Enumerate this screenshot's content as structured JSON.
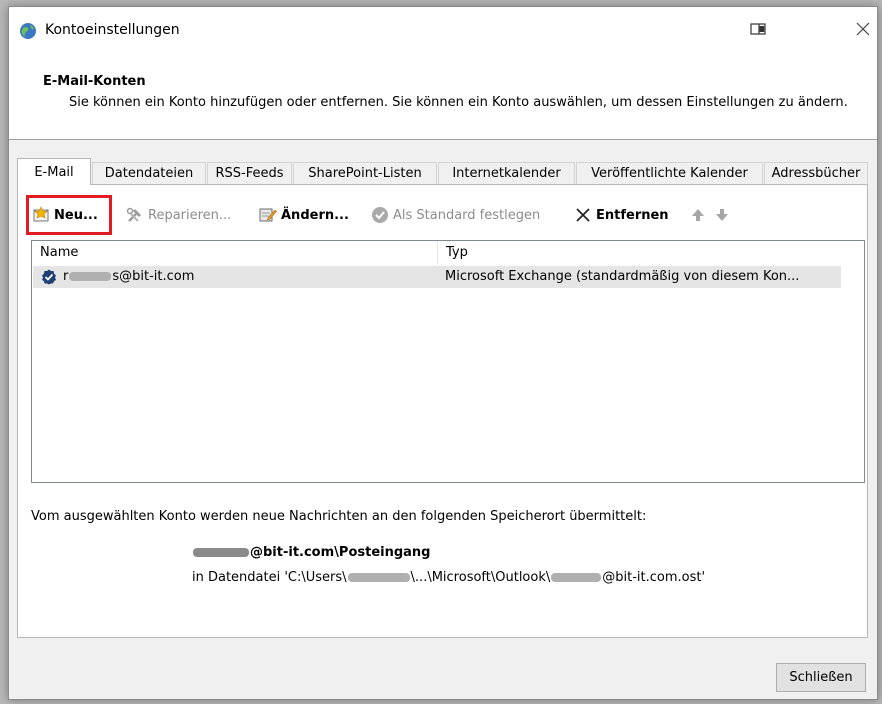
{
  "window": {
    "title": "Kontoeinstellungen"
  },
  "header": {
    "title": "E-Mail-Konten",
    "description": "Sie können ein Konto hinzufügen oder entfernen. Sie können ein Konto auswählen, um dessen Einstellungen zu ändern."
  },
  "tabs": [
    {
      "label": "E-Mail",
      "active": true
    },
    {
      "label": "Datendateien"
    },
    {
      "label": "RSS-Feeds"
    },
    {
      "label": "SharePoint-Listen"
    },
    {
      "label": "Internetkalender"
    },
    {
      "label": "Veröffentlichte Kalender"
    },
    {
      "label": "Adressbücher"
    }
  ],
  "toolbar": {
    "new": "Neu...",
    "repair": "Reparieren...",
    "change": "Ändern...",
    "set_default": "Als Standard festlegen",
    "remove": "Entfernen"
  },
  "list": {
    "columns": {
      "name": "Name",
      "type": "Typ"
    },
    "rows": [
      {
        "name_prefix": "r",
        "name_suffix": "s@bit-it.com",
        "type": "Microsoft Exchange (standardmäßig von diesem Kon..."
      }
    ]
  },
  "delivery": {
    "info": "Vom ausgewählten Konto werden neue Nachrichten an den folgenden Speicherort übermittelt:",
    "folder_suffix": "@bit-it.com\\Posteingang",
    "datafile_prefix": "in Datendatei 'C:\\Users\\",
    "datafile_middle": "\\...\\Microsoft\\Outlook\\",
    "datafile_suffix": "@bit-it.com.ost'"
  },
  "footer": {
    "close_label": "Schließen"
  },
  "colors": {
    "highlight": "#e31b23",
    "accent": "#0078d7"
  }
}
